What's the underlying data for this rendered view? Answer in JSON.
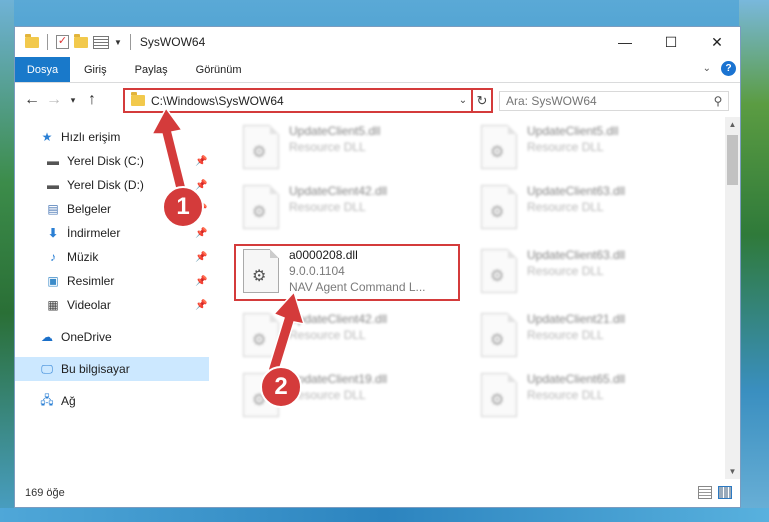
{
  "window": {
    "title": "SysWOW64",
    "minimize": "—",
    "maximize": "☐",
    "close": "✕"
  },
  "ribbon": {
    "tabs": [
      "Dosya",
      "Giriş",
      "Paylaş",
      "Görünüm"
    ],
    "help": "?"
  },
  "address": {
    "path": "C:\\Windows\\SysWOW64",
    "search_placeholder": "Ara: SysWOW64"
  },
  "nav": {
    "items": [
      {
        "label": "Hızlı erişim",
        "icon": "star-icon"
      },
      {
        "label": "Yerel Disk (C:)",
        "icon": "drive-icon",
        "pinned": true
      },
      {
        "label": "Yerel Disk (D:)",
        "icon": "drive-icon",
        "pinned": true
      },
      {
        "label": "Belgeler",
        "icon": "documents-icon",
        "pinned": true
      },
      {
        "label": "İndirmeler",
        "icon": "download-icon",
        "pinned": true
      },
      {
        "label": "Müzik",
        "icon": "music-icon",
        "pinned": true
      },
      {
        "label": "Resimler",
        "icon": "pictures-icon",
        "pinned": true
      },
      {
        "label": "Videolar",
        "icon": "videos-icon",
        "pinned": true
      },
      {
        "label": "OneDrive",
        "icon": "cloud-icon"
      },
      {
        "label": "Bu bilgisayar",
        "icon": "computer-icon",
        "selected": true
      },
      {
        "label": "Ağ",
        "icon": "network-icon"
      }
    ]
  },
  "files": [
    {
      "name": "UpdateClient5.dll",
      "sub": "Resource DLL",
      "blurred": true
    },
    {
      "name": "UpdateClient5.dll",
      "sub": "Resource DLL",
      "blurred": true
    },
    {
      "name": "UpdateClient42.dll",
      "sub": "Resource DLL",
      "blurred": true
    },
    {
      "name": "UpdateClient63.dll",
      "sub": "Resource DLL",
      "blurred": true
    },
    {
      "name": "a0000208.dll",
      "sub": "9.0.0.1104",
      "sub2": "NAV Agent Command L...",
      "blurred": false
    },
    {
      "name": "UpdateClient63.dll",
      "sub": "Resource DLL",
      "blurred": true
    },
    {
      "name": "UpdateClient42.dll",
      "sub": "Resource DLL",
      "blurred": true
    },
    {
      "name": "UpdateClient21.dll",
      "sub": "Resource DLL",
      "blurred": true
    },
    {
      "name": "UpdateClient19.dll",
      "sub": "Resource DLL",
      "blurred": true
    },
    {
      "name": "UpdateClient65.dll",
      "sub": "Resource DLL",
      "blurred": true
    }
  ],
  "status": {
    "count": "169 öğe"
  },
  "annotations": {
    "marker1": "1",
    "marker2": "2",
    "color": "#d43b3b"
  }
}
